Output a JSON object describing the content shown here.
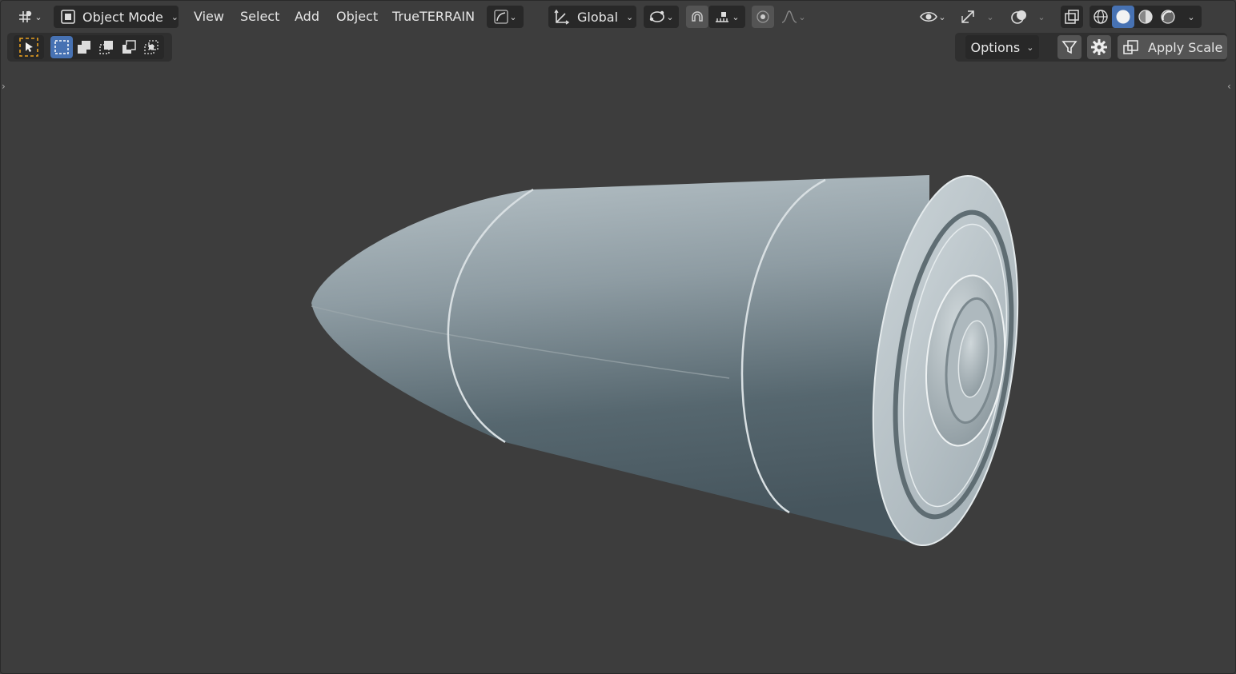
{
  "header": {
    "editor_type_icon": "editor-type-icon",
    "mode_selector": {
      "label": "Object Mode",
      "icon": "object-mode-icon"
    },
    "menus": [
      "View",
      "Select",
      "Add",
      "Object",
      "TrueTERRAIN"
    ],
    "transform_orientation": {
      "label": "Global",
      "icon": "transform-orientation-icon"
    },
    "pivot_icon": "pivot-point-icon",
    "snap_icon": "snap-magnet-icon",
    "snap_target_icon": "snap-increment-icon",
    "proportional_icon": "proportional-editing-icon",
    "falloff_icon": "proportional-falloff-icon",
    "visibility_icon": "eye-visibility-icon",
    "gizmo_icon": "gizmo-icon",
    "overlay_icon": "overlays-icon",
    "xray_icon": "xray-icon",
    "shading_modes": [
      "wireframe",
      "solid",
      "material-preview",
      "rendered"
    ],
    "active_shading": "solid"
  },
  "toolbar2": {
    "tool_icon": "select-tool-icon",
    "selection_modes": [
      "set-new-selection",
      "extend-selection",
      "subtract-selection",
      "invert-selection",
      "intersect-selection"
    ],
    "options_label": "Options",
    "filter_icon": "filter-icon",
    "settings_icon": "gear-icon",
    "apply_scale_label": "Apply Scale",
    "apply_scale_icon": "apply-scale-icon"
  },
  "colors": {
    "background": "#3d3d3d",
    "header_button": "#282828",
    "active_button": "#4772b3",
    "model_light": "#b6c1c6",
    "model_dark": "#4a5a61",
    "select_tool_accent": "#e8a020"
  }
}
